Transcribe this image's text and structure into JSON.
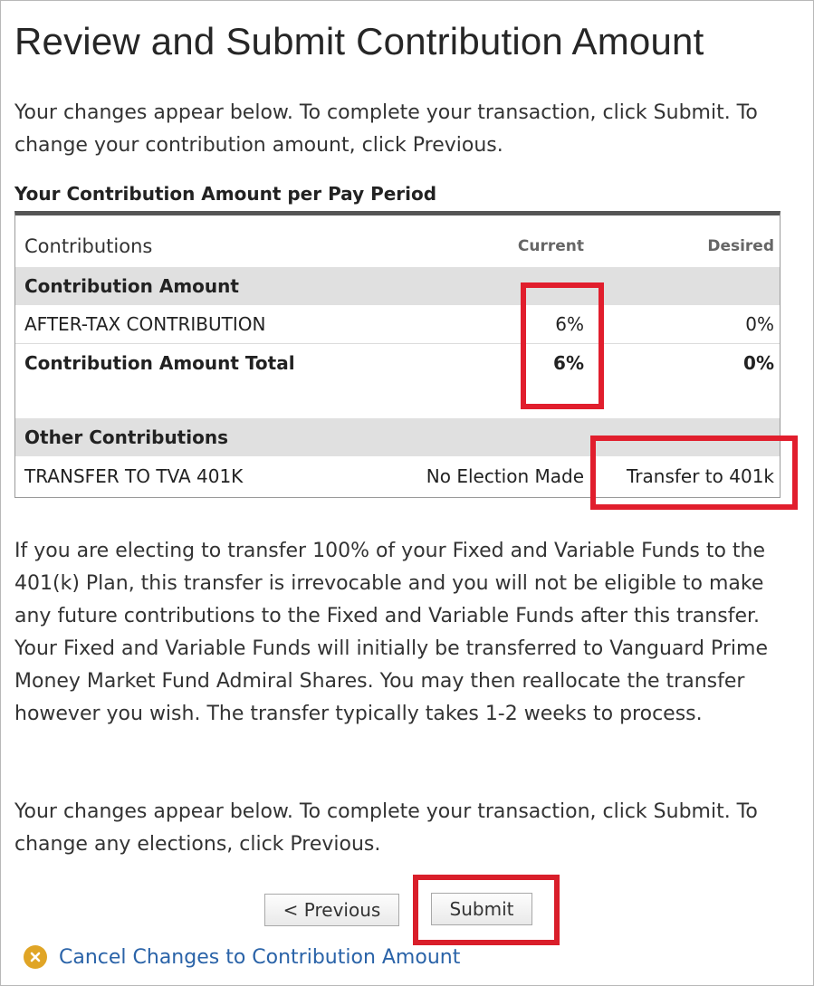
{
  "page": {
    "title": "Review and Submit Contribution Amount",
    "intro": "Your changes appear below. To complete your transaction, click Submit. To change your contribution amount, click Previous."
  },
  "table": {
    "caption": "Your Contribution Amount per Pay Period",
    "headers": {
      "contributions": "Contributions",
      "current": "Current",
      "desired": "Desired"
    },
    "sections": [
      {
        "title": "Contribution Amount",
        "rows": [
          {
            "label": "AFTER-TAX CONTRIBUTION",
            "current": "6%",
            "desired": "0%"
          },
          {
            "label": "Contribution Amount Total",
            "current": "6%",
            "desired": "0%"
          }
        ]
      },
      {
        "title": "Other Contributions",
        "rows": [
          {
            "label": "TRANSFER TO TVA 401K",
            "current": "No Election Made",
            "desired": "Transfer to 401k"
          }
        ]
      }
    ]
  },
  "disclaimer": "If you are electing to transfer 100% of your Fixed and Variable Funds to the 401(k) Plan, this transfer is irrevocable and you will not be eligible to make any future contributions to the Fixed and Variable Funds after this transfer. Your Fixed and Variable Funds will initially be transferred to Vanguard Prime Money Market Fund Admiral Shares. You may then reallocate the transfer however you wish. The transfer typically takes 1-2 weeks to process.",
  "outro": "Your changes appear below. To complete your transaction, click Submit. To change any elections, click Previous.",
  "buttons": {
    "previous": "< Previous",
    "submit": "Submit"
  },
  "cancel_link": {
    "label": "Cancel Changes to Contribution Amount",
    "icon": "close-circle-icon"
  },
  "colors": {
    "highlight": "#e11e2d",
    "link": "#2a63a8",
    "cancel_icon": "#e0a526",
    "section_bg": "#e0e0e0"
  }
}
